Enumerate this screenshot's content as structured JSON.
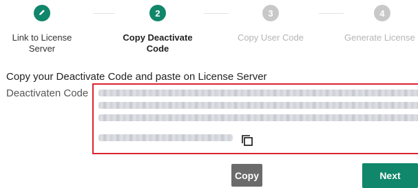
{
  "stepper": {
    "steps": [
      {
        "number": "",
        "label": "Link to License\nServer",
        "state": "done",
        "icon": "pencil-icon"
      },
      {
        "number": "2",
        "label": "Copy Deactivate\nCode",
        "state": "active"
      },
      {
        "number": "3",
        "label": "Copy User Code",
        "state": "todo"
      },
      {
        "number": "4",
        "label": "Generate License",
        "state": "todo"
      }
    ]
  },
  "section": {
    "instruction": "Copy your Deactivate Code and paste on License Server",
    "field_label": "Deactivaten Code",
    "code_value_obscured": true,
    "copy_icon": "copy-icon"
  },
  "buttons": {
    "copy_label": "Copy",
    "next_label": "Next"
  },
  "colors": {
    "accent": "#10866a",
    "error_border": "#d9232e",
    "copy_button": "#6b6b6b",
    "inactive_step": "#c8c8c8"
  }
}
